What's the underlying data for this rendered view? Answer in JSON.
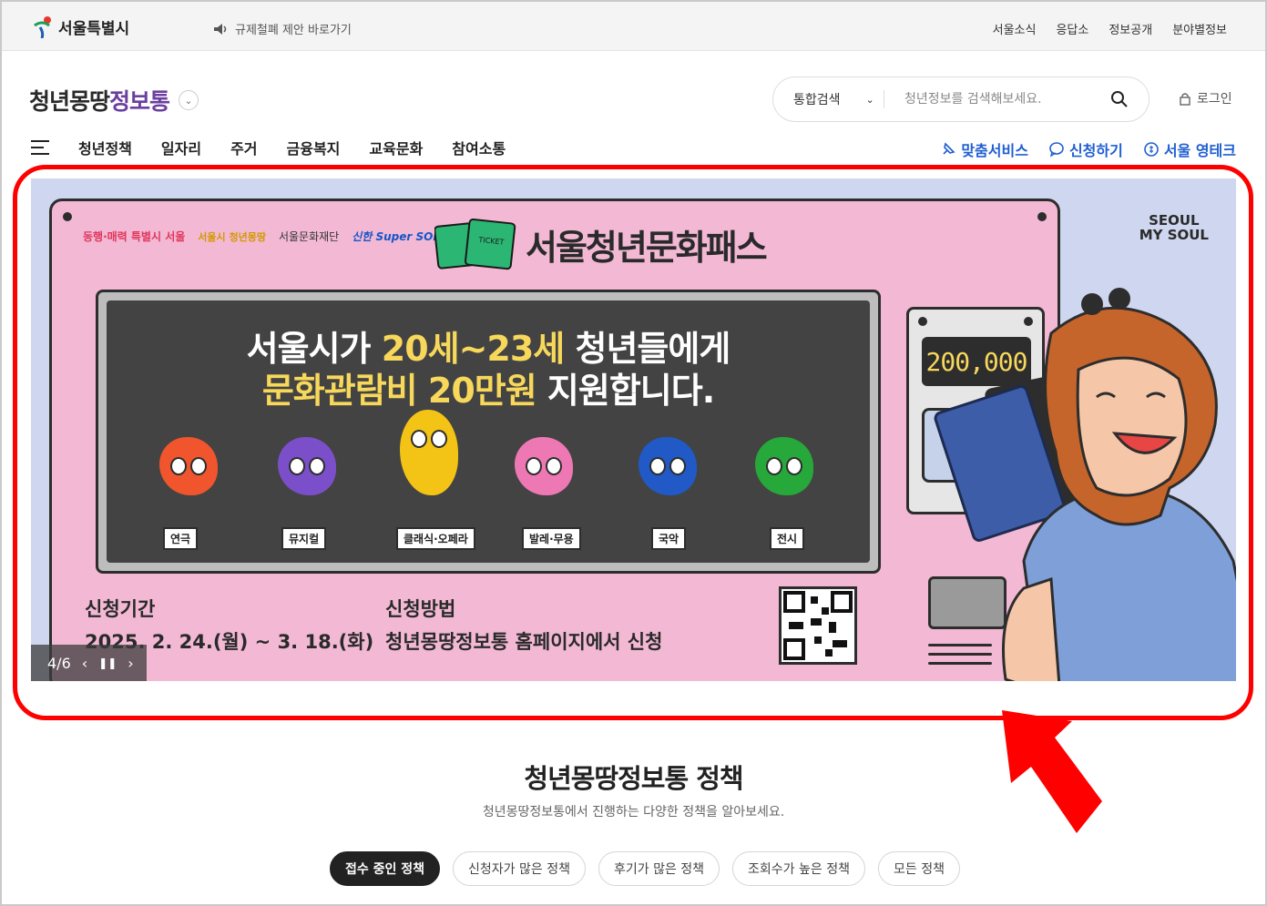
{
  "govbar": {
    "logo_text": "서울특별시",
    "notice": "규제철폐 제안 바로가기",
    "links": [
      "서울소식",
      "응답소",
      "정보공개",
      "분야별정보"
    ]
  },
  "header": {
    "brand_a": "청년몽땅",
    "brand_b": "정보통",
    "search_scope": "통합검색",
    "search_placeholder": "청년정보를 검색해보세요.",
    "login": "로그인"
  },
  "nav": {
    "items": [
      "청년정책",
      "일자리",
      "주거",
      "금융복지",
      "교육문화",
      "참여소통"
    ],
    "quick": [
      "맞춤서비스",
      "신청하기",
      "서울 영테크"
    ]
  },
  "banner": {
    "sponsors": [
      "동행·매력 특별시 서울",
      "서울시 청년몽땅",
      "서울문화재단",
      "신한 Super SOL"
    ],
    "pass_title": "서울청년문화패스",
    "ticket_text": "TICKET",
    "headline_1a": "서울시가 ",
    "headline_1b": "20세~23세",
    "headline_1c": " 청년들에게",
    "headline_2a": "문화관람비 20만원",
    "headline_2b": " 지원합니다.",
    "genres": [
      "연극",
      "뮤지컬",
      "클래식·오페라",
      "발레·무용",
      "국악",
      "전시"
    ],
    "period_label": "신청기간",
    "period_value": "2025. 2. 24.(월) ~ 3. 18.(화)",
    "method_label": "신청방법",
    "method_value": "청년몽땅정보통 홈페이지에서 신청",
    "counter": "200,000",
    "seoul_logo_1": "SEOUL",
    "seoul_logo_2": "MY SOUL",
    "slide_counter": "4/6"
  },
  "section": {
    "title": "청년몽땅정보통 정책",
    "subtitle": "청년몽땅정보통에서 진행하는 다양한 정책을 알아보세요.",
    "chips": [
      "접수 중인 정책",
      "신청자가 많은 정책",
      "후기가 많은 정책",
      "조회수가 높은 정책",
      "모든 정책"
    ]
  },
  "colors": {
    "highlight": "#ff0000",
    "quick_link": "#1f5fd1",
    "banner_pink": "#f2b8d4",
    "screen_dark": "#434343",
    "headline_yellow": "#f7d85b"
  }
}
